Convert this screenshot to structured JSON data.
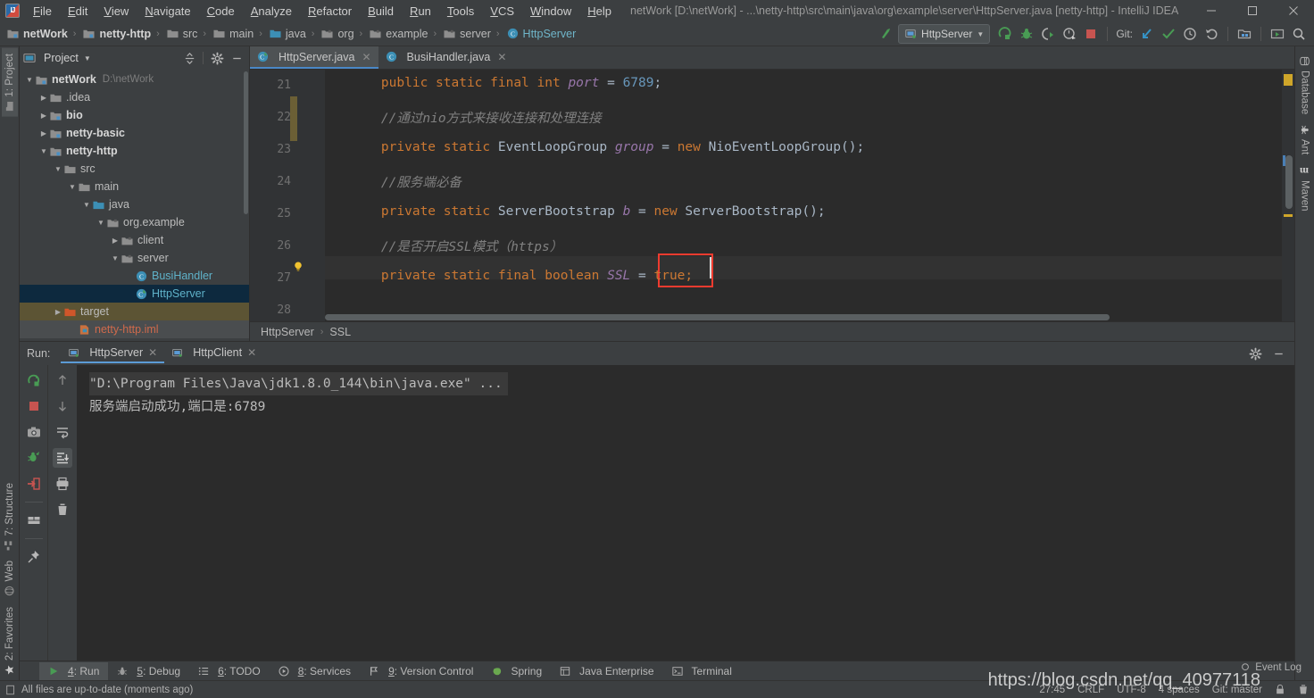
{
  "window": {
    "title": "netWork [D:\\netWork] - ...\\netty-http\\src\\main\\java\\org\\example\\server\\HttpServer.java [netty-http] - IntelliJ IDEA",
    "minimize": "—",
    "maximize": "☐",
    "close": "✕"
  },
  "menu": {
    "items": [
      {
        "label": "File"
      },
      {
        "label": "Edit"
      },
      {
        "label": "View"
      },
      {
        "label": "Navigate"
      },
      {
        "label": "Code"
      },
      {
        "label": "Analyze"
      },
      {
        "label": "Refactor"
      },
      {
        "label": "Build"
      },
      {
        "label": "Run"
      },
      {
        "label": "Tools"
      },
      {
        "label": "VCS"
      },
      {
        "label": "Window"
      },
      {
        "label": "Help"
      }
    ]
  },
  "navbar": {
    "breadcrumbs": [
      {
        "label": "netWork",
        "icon": "module-icon"
      },
      {
        "label": "netty-http",
        "icon": "module-icon"
      },
      {
        "label": "src",
        "icon": "folder-icon"
      },
      {
        "label": "main",
        "icon": "folder-icon"
      },
      {
        "label": "java",
        "icon": "source-folder-icon"
      },
      {
        "label": "org",
        "icon": "package-icon"
      },
      {
        "label": "example",
        "icon": "package-icon"
      },
      {
        "label": "server",
        "icon": "package-icon"
      },
      {
        "label": "HttpServer",
        "icon": "class-icon"
      }
    ],
    "separator": "›",
    "run_config": "HttpServer",
    "git_label": "Git:"
  },
  "project_panel": {
    "title": "Project",
    "tree": [
      {
        "label": "netWork",
        "path": "D:\\netWork",
        "depth": 0,
        "twist": "▼",
        "icon": "module-icon",
        "style": "bold"
      },
      {
        "label": ".idea",
        "path": "",
        "depth": 1,
        "twist": "▶",
        "icon": "folder-icon",
        "style": ""
      },
      {
        "label": "bio",
        "path": "",
        "depth": 1,
        "twist": "▶",
        "icon": "module-icon",
        "style": "bold"
      },
      {
        "label": "netty-basic",
        "path": "",
        "depth": 1,
        "twist": "▶",
        "icon": "module-icon",
        "style": "bold"
      },
      {
        "label": "netty-http",
        "path": "",
        "depth": 1,
        "twist": "▼",
        "icon": "module-icon",
        "style": "bold"
      },
      {
        "label": "src",
        "path": "",
        "depth": 2,
        "twist": "▼",
        "icon": "folder-icon",
        "style": ""
      },
      {
        "label": "main",
        "path": "",
        "depth": 3,
        "twist": "▼",
        "icon": "folder-icon",
        "style": ""
      },
      {
        "label": "java",
        "path": "",
        "depth": 4,
        "twist": "▼",
        "icon": "source-folder-icon",
        "style": ""
      },
      {
        "label": "org.example",
        "path": "",
        "depth": 5,
        "twist": "▼",
        "icon": "package-icon",
        "style": ""
      },
      {
        "label": "client",
        "path": "",
        "depth": 6,
        "twist": "▶",
        "icon": "package-icon",
        "style": ""
      },
      {
        "label": "server",
        "path": "",
        "depth": 6,
        "twist": "▼",
        "icon": "package-icon",
        "style": ""
      },
      {
        "label": "BusiHandler",
        "path": "",
        "depth": 7,
        "twist": "",
        "icon": "class-icon",
        "style": "teal"
      },
      {
        "label": "HttpServer",
        "path": "",
        "depth": 7,
        "twist": "",
        "icon": "runnable-class-icon",
        "style": "teal selected"
      },
      {
        "label": "target",
        "path": "",
        "depth": 2,
        "twist": "▶",
        "icon": "excluded-folder-icon",
        "style": "target"
      },
      {
        "label": "netty-http.iml",
        "path": "",
        "depth": 3,
        "twist": "",
        "icon": "iml-icon",
        "style": "red iml"
      }
    ]
  },
  "editor": {
    "tabs": [
      {
        "label": "HttpServer.java",
        "icon": "runnable-class-icon",
        "active": true,
        "close": "✕"
      },
      {
        "label": "BusiHandler.java",
        "icon": "class-icon",
        "active": false,
        "close": "✕"
      }
    ],
    "lines": [
      {
        "num": "21",
        "segments": [
          {
            "t": "    ",
            "c": "p"
          },
          {
            "t": "public static final ",
            "c": "k"
          },
          {
            "t": "int ",
            "c": "k"
          },
          {
            "t": "port ",
            "c": "f"
          },
          {
            "t": "= ",
            "c": "p"
          },
          {
            "t": "6789",
            "c": "n"
          },
          {
            "t": ";",
            "c": "p"
          }
        ]
      },
      {
        "num": "22",
        "segments": [
          {
            "t": "    //通过nio方式来接收连接和处理连接",
            "c": "cm"
          }
        ]
      },
      {
        "num": "23",
        "segments": [
          {
            "t": "    ",
            "c": "p"
          },
          {
            "t": "private static ",
            "c": "k"
          },
          {
            "t": "EventLoopGroup ",
            "c": "t"
          },
          {
            "t": "group ",
            "c": "f"
          },
          {
            "t": "= ",
            "c": "p"
          },
          {
            "t": "new ",
            "c": "k"
          },
          {
            "t": "NioEventLoopGroup",
            "c": "t"
          },
          {
            "t": "();",
            "c": "p"
          }
        ]
      },
      {
        "num": "24",
        "segments": [
          {
            "t": "    //服务端必备",
            "c": "cm"
          }
        ]
      },
      {
        "num": "25",
        "segments": [
          {
            "t": "    ",
            "c": "p"
          },
          {
            "t": "private static ",
            "c": "k"
          },
          {
            "t": "ServerBootstrap ",
            "c": "t"
          },
          {
            "t": "b ",
            "c": "f"
          },
          {
            "t": "= ",
            "c": "p"
          },
          {
            "t": "new ",
            "c": "k"
          },
          {
            "t": "ServerBootstrap",
            "c": "t"
          },
          {
            "t": "();",
            "c": "p"
          }
        ]
      },
      {
        "num": "26",
        "segments": [
          {
            "t": "    //是否开启SSL模式（https）",
            "c": "cm"
          }
        ]
      },
      {
        "num": "27",
        "segments": [
          {
            "t": "    ",
            "c": "p"
          },
          {
            "t": "private static final boolean ",
            "c": "k"
          },
          {
            "t": "SSL ",
            "c": "f"
          },
          {
            "t": "= ",
            "c": "p"
          },
          {
            "t": "true;",
            "c": "k"
          }
        ]
      },
      {
        "num": "28",
        "segments": []
      }
    ],
    "breadcrumb": [
      "HttpServer",
      "SSL"
    ],
    "breadcrumb_sep": "›"
  },
  "left_strip": {
    "tabs": [
      {
        "label": "1: Project",
        "underline": "1",
        "active": true,
        "icon": "project-icon"
      },
      {
        "label": "7: Structure",
        "underline": "7",
        "active": false,
        "icon": "structure-icon"
      },
      {
        "label": "Web",
        "underline": "",
        "active": false,
        "icon": "web-icon"
      },
      {
        "label": "2: Favorites",
        "underline": "2",
        "active": false,
        "icon": "star-icon"
      }
    ]
  },
  "right_strip": {
    "tabs": [
      {
        "label": "Database",
        "icon": "database-icon"
      },
      {
        "label": "Ant",
        "icon": "ant-icon"
      },
      {
        "label": "Maven",
        "icon": "maven-icon"
      }
    ]
  },
  "run_panel": {
    "label": "Run:",
    "tabs": [
      {
        "label": "HttpServer",
        "active": true,
        "close": "✕",
        "icon": "run-config-icon"
      },
      {
        "label": "HttpClient",
        "active": false,
        "close": "✕",
        "icon": "run-config-icon"
      }
    ],
    "console": [
      {
        "text": "\"D:\\Program Files\\Java\\jdk1.8.0_144\\bin\\java.exe\" ...",
        "highlight": true
      },
      {
        "text": "服务端启动成功,端口是:6789",
        "highlight": false
      }
    ]
  },
  "toolwindow_bar": {
    "items": [
      {
        "label": "4: Run",
        "underline": "4",
        "icon": "run-icon",
        "active": true
      },
      {
        "label": "5: Debug",
        "underline": "5",
        "icon": "debug-icon",
        "active": false
      },
      {
        "label": "6: TODO",
        "underline": "6",
        "icon": "todo-icon",
        "active": false
      },
      {
        "label": "8: Services",
        "underline": "8",
        "icon": "services-icon",
        "active": false
      },
      {
        "label": "9: Version Control",
        "underline": "9",
        "icon": "vcs-icon",
        "active": false
      },
      {
        "label": "Spring",
        "underline": "",
        "icon": "spring-icon",
        "active": false
      },
      {
        "label": "Java Enterprise",
        "underline": "",
        "icon": "java-ee-icon",
        "active": false
      },
      {
        "label": "Terminal",
        "underline": "",
        "icon": "terminal-icon",
        "active": false
      }
    ]
  },
  "status_bar": {
    "message": "All files are up-to-date (moments ago)",
    "caret_position": "27:45",
    "line_separator": "CRLF",
    "encoding": "UTF-8",
    "indent": "4 spaces",
    "branch": "Git: master",
    "event_log": "Event Log"
  },
  "watermark": "https://blog.csdn.net/qq_40977118",
  "colors": {
    "panel_bg": "#3c3f41",
    "editor_bg": "#2b2b2b",
    "gutter_bg": "#313335",
    "selection_blue": "#0d293e",
    "accent_blue": "#4a88c7",
    "keyword_orange": "#cc7832",
    "string_green": "#6a8759",
    "number_blue": "#6897bb",
    "field_purple": "#9876aa",
    "comment_gray": "#808080",
    "highlight_red": "#ee3b2f",
    "target_brown": "#5c5434"
  }
}
